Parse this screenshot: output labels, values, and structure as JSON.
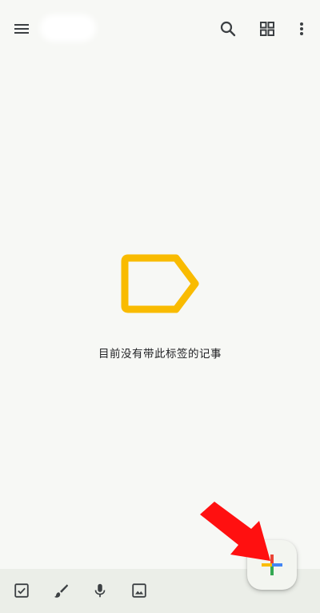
{
  "topbar": {
    "title": "",
    "icons": [
      "menu-icon",
      "search-icon",
      "grid-view-icon",
      "more-vert-icon"
    ]
  },
  "empty_state": {
    "icon": "label-outline-icon",
    "message": "目前没有带此标签的记事"
  },
  "bottom_bar": {
    "icons": [
      "checkbox-icon",
      "brush-icon",
      "mic-icon",
      "image-icon"
    ]
  },
  "fab": {
    "icon": "plus-multicolor-icon"
  },
  "annotation": {
    "icon": "red-arrow-icon"
  },
  "colors": {
    "background": "#f7f8f5",
    "label_icon": "#f9bb00",
    "bottom_bar": "#ebeee8",
    "arrow": "#ff1010",
    "plus_blue": "#4285f4",
    "plus_red": "#ea4335",
    "plus_yellow": "#fbbc04",
    "plus_green": "#34a853"
  }
}
